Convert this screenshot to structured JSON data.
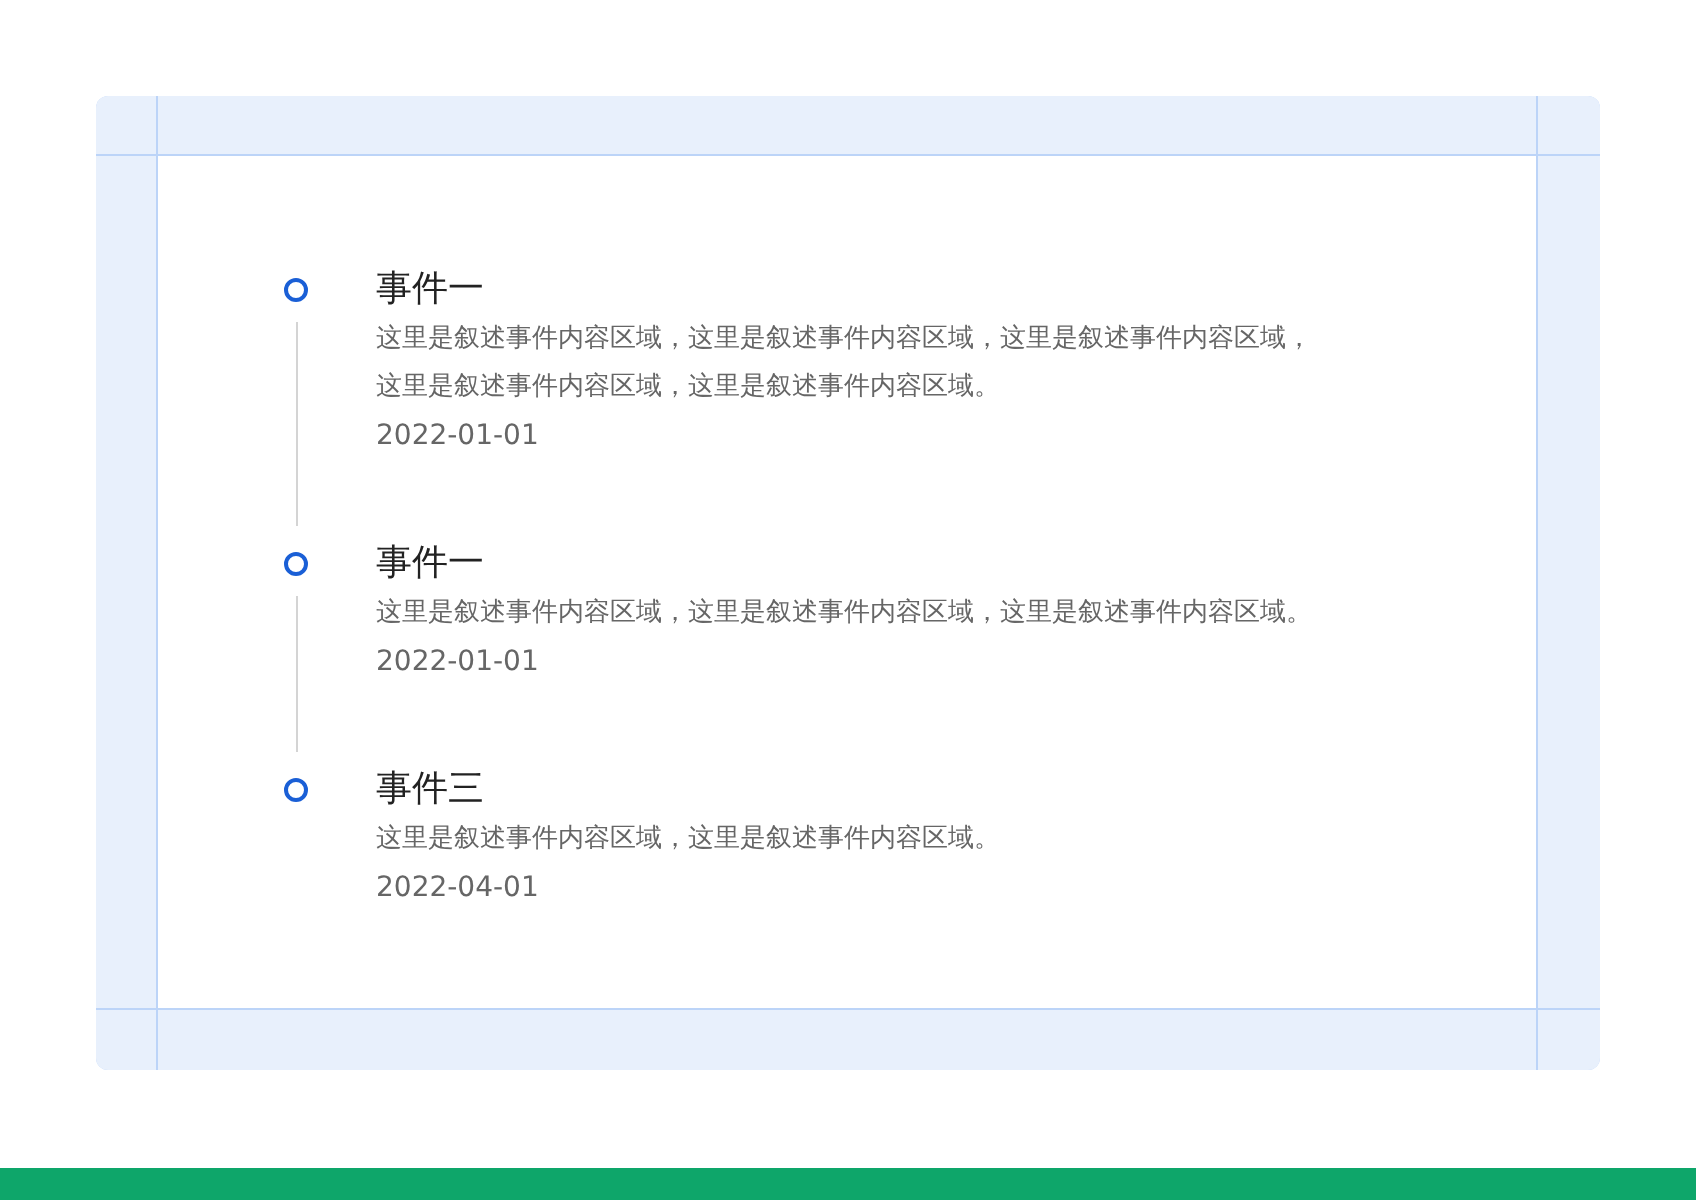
{
  "timeline": [
    {
      "title": "事件一",
      "description": "这里是叙述事件内容区域，这里是叙述事件内容区域，这里是叙述事件内容区域，这里是叙述事件内容区域，这里是叙述事件内容区域。",
      "date": "2022-01-01"
    },
    {
      "title": "事件一",
      "description": "这里是叙述事件内容区域，这里是叙述事件内容区域，这里是叙述事件内容区域。",
      "date": "2022-01-01"
    },
    {
      "title": "事件三",
      "description": "这里是叙述事件内容区域，这里是叙述事件内容区域。",
      "date": "2022-04-01"
    }
  ]
}
